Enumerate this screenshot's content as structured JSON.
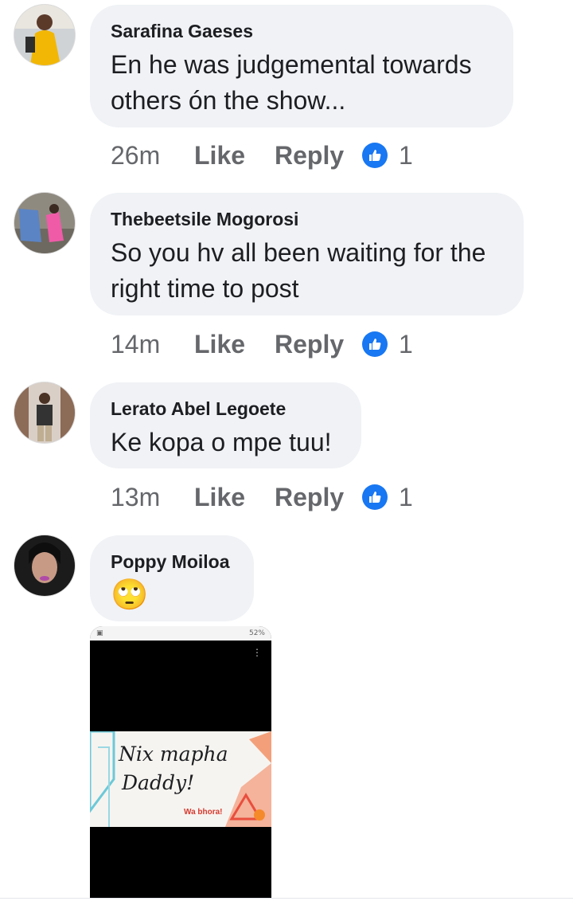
{
  "comments": [
    {
      "author": "Sarafina Gaeses",
      "text": "En he was judgemental towards others ón the show...",
      "time": "26m",
      "like": "Like",
      "reply": "Reply",
      "reaction_count": "1"
    },
    {
      "author": "Thebeetsile Mogorosi",
      "text": "So you hv all been waiting for the right time to post",
      "time": "14m",
      "like": "Like",
      "reply": "Reply",
      "reaction_count": "1"
    },
    {
      "author": "Lerato Abel Legoete",
      "text": "Ke kopa o mpe tuu!",
      "time": "13m",
      "like": "Like",
      "reply": "Reply",
      "reaction_count": "1"
    },
    {
      "author": "Poppy Moiloa",
      "text": "🙄"
    }
  ],
  "attachment": {
    "status_right": "52%",
    "banner_line1": "Nix mapha",
    "banner_line2": "Daddy!",
    "banner_tag": "Wa bhora!"
  },
  "icons": {
    "reaction": "like-thumb-icon"
  },
  "colors": {
    "bubble": "#f0f2f5",
    "reaction": "#1877f2",
    "meta_text": "#65676b"
  }
}
